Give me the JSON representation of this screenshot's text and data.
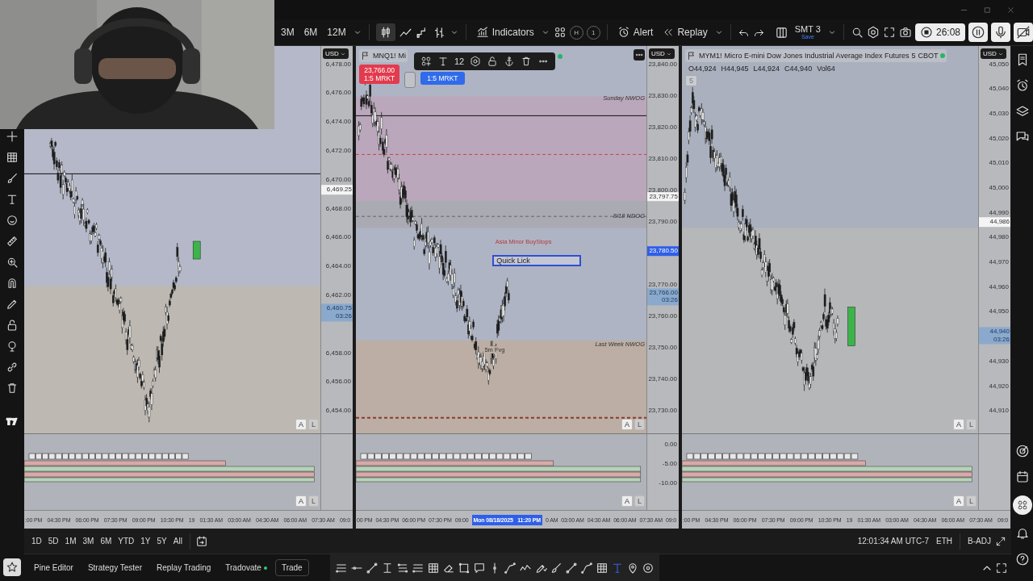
{
  "toolbar": {
    "intervals": [
      "3M",
      "6M",
      "12M"
    ],
    "indicators_label": "Indicators",
    "badges": [
      "H",
      "1"
    ],
    "alert_label": "Alert",
    "replay_label": "Replay",
    "layout_name": "SMT 3",
    "layout_status": "Save",
    "record_time": "26:08"
  },
  "panes": [
    {
      "currency": "USD",
      "price_ticks": [
        "6,478.00",
        "6,476.00",
        "6,474.00",
        "6,472.00",
        "6,470.00",
        "6,468.00",
        "6,466.00",
        "6,464.00",
        "6,462.00",
        "6,458.00",
        "6,456.00",
        "6,454.00"
      ],
      "price_tags": [
        {
          "kind": "marker",
          "value": "6,469.25"
        },
        {
          "kind": "current",
          "value": "6,460.75",
          "countdown": "03:26"
        }
      ],
      "main_scale": [
        "A",
        "L"
      ],
      "sub_scale": [
        "A",
        "L"
      ],
      "time_ticks": [
        {
          "kind": "tick",
          "text": ":00 PM"
        },
        {
          "kind": "tick",
          "text": "04:30 PM"
        },
        {
          "kind": "tick",
          "text": "06:00 PM"
        },
        {
          "kind": "tick",
          "text": "07:30 PM"
        },
        {
          "kind": "tick",
          "text": "09:00 PM"
        },
        {
          "kind": "tick",
          "text": "10:30 PM"
        },
        {
          "kind": "tick",
          "text": "19"
        },
        {
          "kind": "tick",
          "text": "01:30 AM"
        },
        {
          "kind": "tick",
          "text": "03:00 AM"
        },
        {
          "kind": "tick",
          "text": "04:30 AM"
        },
        {
          "kind": "tick",
          "text": "06:00 AM"
        },
        {
          "kind": "tick",
          "text": "07:30 AM"
        },
        {
          "kind": "tick",
          "text": "09:0"
        }
      ]
    },
    {
      "currency": "USD",
      "symbol": "MNQ1!",
      "description": "Mi",
      "orders": [
        {
          "kind": "sell",
          "price": "23,766.00",
          "label": "1:5 MRKT"
        },
        {
          "kind": "buy",
          "label": "1:5 MRKT"
        }
      ],
      "float_toolbar": {
        "font_size": "12"
      },
      "annotations": [
        {
          "kind": "level",
          "text": "Sunday NWOG"
        },
        {
          "kind": "level",
          "text": "8/18 NDOG"
        },
        {
          "kind": "note",
          "text": "Asia Minor BuyStops"
        },
        {
          "kind": "textbox",
          "text": "Quick Lick"
        },
        {
          "kind": "level",
          "text": "Last Week NWOG"
        },
        {
          "kind": "label",
          "text": "5m Fvg"
        }
      ],
      "price_ticks": [
        "23,840.00",
        "23,830.00",
        "23,820.00",
        "23,810.00",
        "23,800.00",
        "23,790.00",
        "23,770.00",
        "23,760.00",
        "23,750.00",
        "23,740.00",
        "23,730.00"
      ],
      "price_tags": [
        {
          "kind": "marker",
          "value": "23,797.75"
        },
        {
          "kind": "alert",
          "value": "23,780.50"
        },
        {
          "kind": "current",
          "value": "23,766.00",
          "countdown": "03:26"
        }
      ],
      "sub_ticks": [
        "0.00",
        "-5.00",
        "-10.00"
      ],
      "main_scale": [
        "A",
        "L"
      ],
      "sub_scale": [
        "A",
        "L"
      ],
      "time_ticks": [
        {
          "kind": "tick",
          "text": "00 PM"
        },
        {
          "kind": "tick",
          "text": "04:30 PM"
        },
        {
          "kind": "tick",
          "text": "06:00 PM"
        },
        {
          "kind": "tick",
          "text": "07:30 PM"
        },
        {
          "kind": "tick",
          "text": "09:00"
        },
        {
          "kind": "cursor",
          "text": "Mon 08/18/2025   11:20 PM"
        },
        {
          "kind": "tick",
          "text": "0 AM"
        },
        {
          "kind": "tick",
          "text": "03:00 AM"
        },
        {
          "kind": "tick",
          "text": "04:30 AM"
        },
        {
          "kind": "tick",
          "text": "06:00 AM"
        },
        {
          "kind": "tick",
          "text": "07:30 AM"
        },
        {
          "kind": "tick",
          "text": "09:0"
        }
      ]
    },
    {
      "currency": "USD",
      "symbol": "MYM1!",
      "description": "Micro E-mini Dow Jones Industrial Average Index Futures",
      "interval": "5",
      "exchange": "CBOT",
      "ohlc": [
        "O44,924",
        "H44,945",
        "L44,924",
        "C44,940",
        "Vol64"
      ],
      "interval_chip": "5",
      "price_ticks": [
        "45,050",
        "45,040",
        "45,030",
        "45,020",
        "45,010",
        "45,000",
        "44,990",
        "44,980",
        "44,970",
        "44,960",
        "44,950",
        "44,930",
        "44,920",
        "44,910"
      ],
      "price_tags": [
        {
          "kind": "marker",
          "value": "44,986"
        },
        {
          "kind": "current",
          "value": "44,940",
          "countdown": "03:26"
        }
      ],
      "main_scale": [
        "A",
        "L"
      ],
      "sub_scale": [
        "A",
        "L"
      ],
      "time_ticks": [
        {
          "kind": "tick",
          "text": ":00 PM"
        },
        {
          "kind": "tick",
          "text": "04:30 PM"
        },
        {
          "kind": "tick",
          "text": "06:00 PM"
        },
        {
          "kind": "tick",
          "text": "07:30 PM"
        },
        {
          "kind": "tick",
          "text": "09:00 PM"
        },
        {
          "kind": "tick",
          "text": "10:30 PM"
        },
        {
          "kind": "tick",
          "text": "19"
        },
        {
          "kind": "tick",
          "text": "01:30 AM"
        },
        {
          "kind": "tick",
          "text": "03:00 AM"
        },
        {
          "kind": "tick",
          "text": "04:30 AM"
        },
        {
          "kind": "tick",
          "text": "06:00 AM"
        },
        {
          "kind": "tick",
          "text": "07:30 AM"
        },
        {
          "kind": "tick",
          "text": "09:0"
        }
      ]
    }
  ],
  "ranges": [
    "1D",
    "5D",
    "1M",
    "3M",
    "6M",
    "YTD",
    "1Y",
    "5Y",
    "All"
  ],
  "status": {
    "clock": "12:01:34 AM UTC-7",
    "session": "ETH",
    "adjustment": "B-ADJ"
  },
  "bottom_tabs": [
    {
      "label": "Pine Editor",
      "selected": false,
      "connected": false
    },
    {
      "label": "Strategy Tester",
      "selected": false,
      "connected": false
    },
    {
      "label": "Replay Trading",
      "selected": false,
      "connected": false
    },
    {
      "label": "Tradovate",
      "selected": false,
      "connected": true
    },
    {
      "label": "Trade",
      "selected": true,
      "connected": false
    }
  ]
}
